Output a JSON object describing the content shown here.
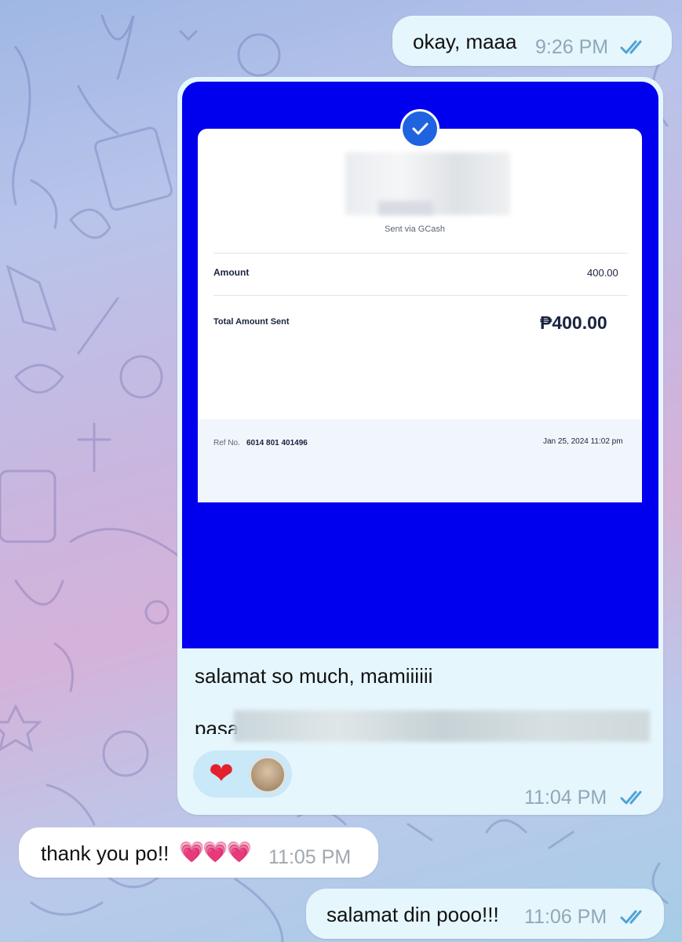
{
  "messages": [
    {
      "text": "okay, maaa",
      "time": "9:26 PM"
    },
    {
      "caption": "salamat so much, mamiiiiii",
      "caption_second_line": "pasa",
      "time": "11:04 PM"
    },
    {
      "text": "thank you po!!",
      "emoji": "💗💗💗",
      "time": "11:05 PM"
    },
    {
      "text": "salamat din pooo!!!",
      "time": "11:06 PM"
    }
  ],
  "receipt": {
    "via": "Sent via GCash",
    "amount_label": "Amount",
    "amount_value": "400.00",
    "total_label": "Total Amount Sent",
    "total_value": "₱400.00",
    "ref_label": "Ref No.",
    "ref_value": "6014 801 401496",
    "date": "Jan 25, 2024 11:02 pm"
  },
  "reactions": {
    "emoji": "❤"
  },
  "colors": {
    "outgoing_bubble": "#e6f6fd",
    "incoming_bubble": "#ffffff",
    "receipt_bg": "#0000ee",
    "read_ticks": "#4fa3d8"
  }
}
